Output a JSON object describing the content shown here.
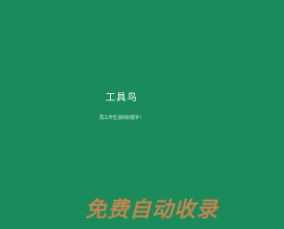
{
  "app": {
    "title": "工具鸟",
    "tagline": "员工作生活的好帮手！"
  },
  "watermark": {
    "text": "免费自动收录"
  },
  "colors": {
    "background": "#1a8c5c",
    "title": "#ffffff",
    "watermark": "#f0824a"
  }
}
